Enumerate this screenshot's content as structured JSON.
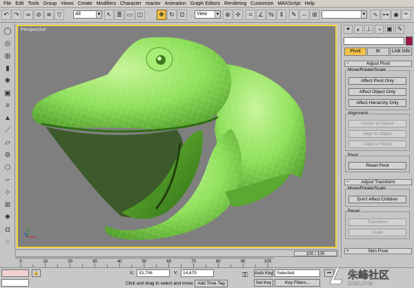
{
  "menu": [
    "File",
    "Edit",
    "Tools",
    "Group",
    "Views",
    "Create",
    "Modifiers",
    "Character",
    "reactor",
    "Animation",
    "Graph Editors",
    "Rendering",
    "Customize",
    "MAXScript",
    "Help"
  ],
  "toolbar": {
    "selection_filter": "All",
    "ref_coord": "View"
  },
  "viewport": {
    "label": "Perspective",
    "mesh_color": "#8ee05a",
    "active_border": "#f2d23a"
  },
  "command_panel": {
    "tabs": [
      "Pivot",
      "IK",
      "Link Info"
    ],
    "active_tab": "Pivot",
    "object_color": "#a0114a",
    "adjust_pivot": {
      "title": "Adjust Pivot",
      "move_group": "Move/Rotate/Scale:",
      "affect_pivot": "Affect Pivot Only",
      "affect_object": "Affect Object Only",
      "affect_hierarchy": "Affect Hierarchy Only",
      "alignment_group": "Alignment:",
      "center_to_object": "Center to Object",
      "align_to_object": "Align to Object",
      "align_to_world": "Align to World",
      "pivot_group": "Pivot:",
      "reset_pivot": "Reset Pivot"
    },
    "adjust_transform": {
      "title": "Adjust Transform",
      "move_group": "Move/Rotate/Scale:",
      "dont_affect_children": "Don't Affect Children",
      "reset_group": "Reset:",
      "transform": "Transform",
      "scale": "Scale"
    },
    "skin_pose": {
      "title": "Skin Pose"
    }
  },
  "timeslider": {
    "label": "100 / 100"
  },
  "timeline": {
    "ticks": [
      "0",
      "10",
      "20",
      "30",
      "40",
      "50",
      "60",
      "70",
      "80",
      "90",
      "100"
    ]
  },
  "status": {
    "x_label": "X:",
    "x_value": "33,706",
    "y_label": "Y:",
    "y_value": "14,675",
    "prompt": "Click and drag to select and move",
    "add_time_tag": "Add Time Tag",
    "auto_key": "Auto Key",
    "set_key": "Set Key",
    "key_mode": "Selected",
    "key_filters": "Key Filters..."
  },
  "watermark": {
    "brand": "朱峰社区",
    "sub": "ZF3D.COM"
  }
}
